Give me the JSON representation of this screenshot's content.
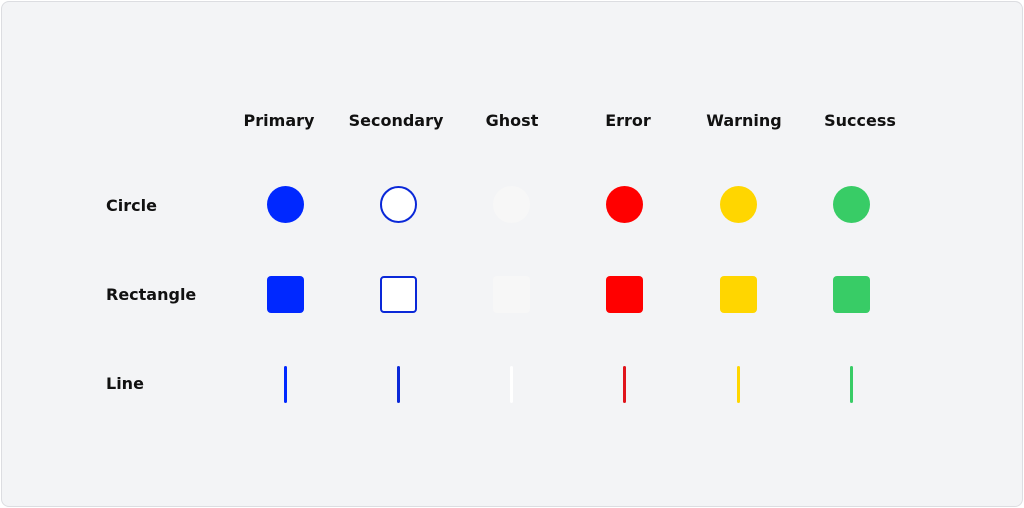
{
  "columns": [
    {
      "label": "Primary",
      "fill": "#0028ff",
      "border": "#0028ff"
    },
    {
      "label": "Secondary",
      "fill": "#ffffff",
      "border": "#0a28d8"
    },
    {
      "label": "Ghost",
      "fill": "#f7f7f7",
      "border": "#f7f7f7"
    },
    {
      "label": "Error",
      "fill": "#ff0000",
      "border": "#ff0000"
    },
    {
      "label": "Warning",
      "fill": "#ffd600",
      "border": "#ffd600"
    },
    {
      "label": "Success",
      "fill": "#38cc66",
      "border": "#38cc66"
    }
  ],
  "line_colors": [
    "#0028ff",
    "#0a28d8",
    "#ffffff",
    "#e0141b",
    "#ffd600",
    "#38cc66"
  ],
  "rows": [
    {
      "label": "Circle"
    },
    {
      "label": "Rectangle"
    },
    {
      "label": "Line"
    }
  ]
}
